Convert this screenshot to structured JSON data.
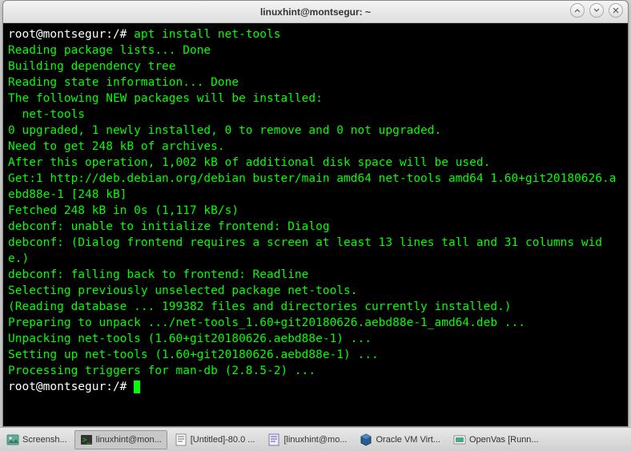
{
  "window": {
    "title": "linuxhint@montsegur: ~"
  },
  "terminal": {
    "prompt1": "root@montsegur:/# ",
    "command": "apt install net-tools",
    "lines": [
      "Reading package lists... Done",
      "Building dependency tree",
      "Reading state information... Done",
      "The following NEW packages will be installed:",
      "  net-tools",
      "0 upgraded, 1 newly installed, 0 to remove and 0 not upgraded.",
      "Need to get 248 kB of archives.",
      "After this operation, 1,002 kB of additional disk space will be used.",
      "Get:1 http://deb.debian.org/debian buster/main amd64 net-tools amd64 1.60+git20180626.aebd88e-1 [248 kB]",
      "Fetched 248 kB in 0s (1,117 kB/s)",
      "debconf: unable to initialize frontend: Dialog",
      "debconf: (Dialog frontend requires a screen at least 13 lines tall and 31 columns wide.)",
      "debconf: falling back to frontend: Readline",
      "Selecting previously unselected package net-tools.",
      "(Reading database ... 199382 files and directories currently installed.)",
      "Preparing to unpack .../net-tools_1.60+git20180626.aebd88e-1_amd64.deb ...",
      "Unpacking net-tools (1.60+git20180626.aebd88e-1) ...",
      "Setting up net-tools (1.60+git20180626.aebd88e-1) ...",
      "Processing triggers for man-db (2.8.5-2) ..."
    ],
    "prompt2": "root@montsegur:/#"
  },
  "taskbar": {
    "items": [
      {
        "label": "Screensh...",
        "icon": "image"
      },
      {
        "label": "linuxhint@mon...",
        "icon": "terminal",
        "active": true
      },
      {
        "label": "[Untitled]-80.0 ...",
        "icon": "text"
      },
      {
        "label": "[linuxhint@mo...",
        "icon": "editor"
      },
      {
        "label": "Oracle VM Virt...",
        "icon": "vbox"
      },
      {
        "label": "OpenVas [Runn...",
        "icon": "vm"
      }
    ]
  }
}
